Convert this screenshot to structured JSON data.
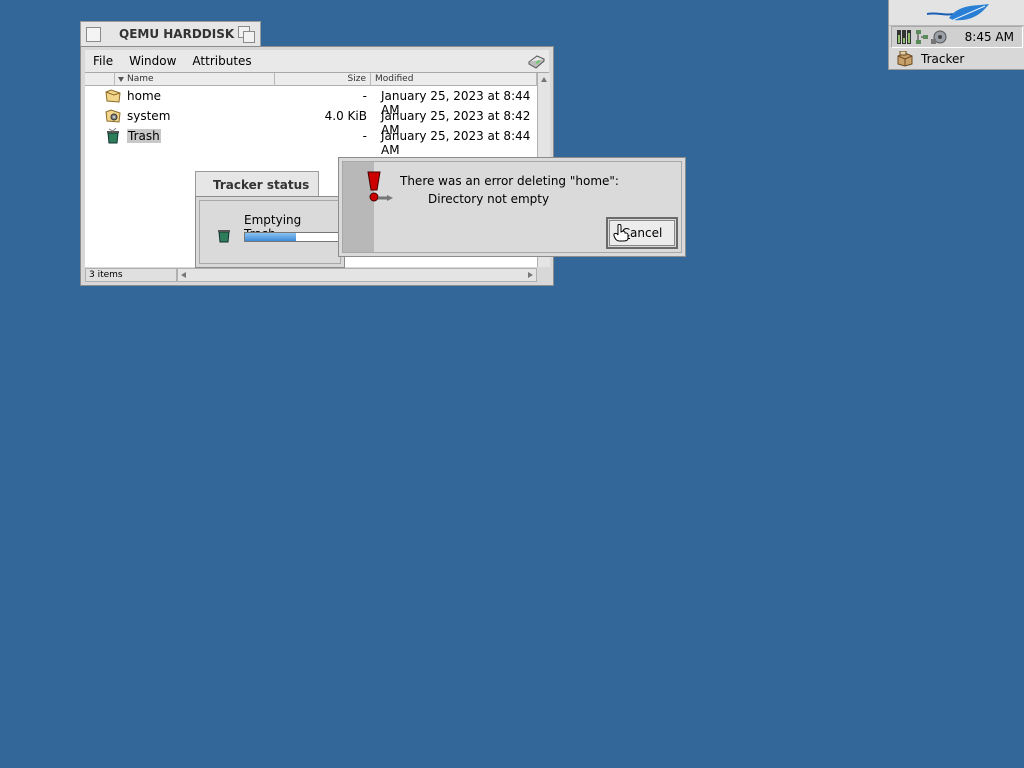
{
  "deskbar": {
    "clock": "8:45 AM",
    "tracker_label": "Tracker",
    "logo_icon": "haiku-leaf-icon"
  },
  "tracker_window": {
    "title": "QEMU HARDDISK",
    "menu": [
      "File",
      "Window",
      "Attributes"
    ],
    "columns": {
      "name": "Name",
      "size": "Size",
      "modified": "Modified"
    },
    "rows": [
      {
        "name": "home",
        "size": "-",
        "modified": "January 25, 2023 at 8:44 AM",
        "icon": "folder-icon"
      },
      {
        "name": "system",
        "size": "4.0 KiB",
        "modified": "January 25, 2023 at 8:42 AM",
        "icon": "system-folder-icon"
      },
      {
        "name": "Trash",
        "size": "-",
        "modified": "January 25, 2023 at 8:44 AM",
        "icon": "trash-icon",
        "selected": true
      }
    ],
    "status_count": "3 items"
  },
  "tracker_status": {
    "title": "Tracker status",
    "message": "Emptying Trash...",
    "progress": 0.5
  },
  "alert": {
    "line1": "There was an error deleting \"home\":",
    "line2": "Directory not empty",
    "cancel_label": "Cancel"
  },
  "colors": {
    "desktop": "#336699",
    "progress": "#3c8ad8",
    "warning": "#cc0000"
  }
}
